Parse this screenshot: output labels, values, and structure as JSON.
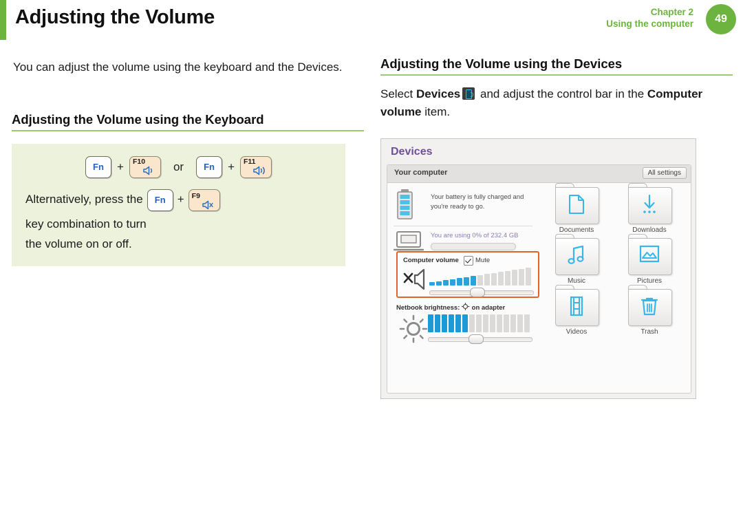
{
  "header": {
    "title": "Adjusting the Volume",
    "chapter_line1": "Chapter 2",
    "chapter_line2": "Using the computer",
    "page_number": "49",
    "accent_green": "#6cb33f"
  },
  "left_column": {
    "intro": "You can adjust the volume using the keyboard and the Devices.",
    "section_heading": "Adjusting the Volume using the Keyboard",
    "callout": {
      "fn_label": "Fn",
      "plus": "+",
      "or_label": "or",
      "key1_label": "F10",
      "key1_icon": "volume-down-icon",
      "key2_label": "F11",
      "key2_icon": "volume-up-icon",
      "alt_text_before": "Alternatively, press the",
      "key3_fn": "Fn",
      "key3_label": "F9",
      "key3_icon": "volume-mute-icon",
      "alt_text_after": "key combination to turn",
      "alt_text_line2": "the volume on or off."
    }
  },
  "right_column": {
    "section_heading": "Adjusting the Volume using the Devices",
    "body_before": "Select ",
    "body_bold1": "Devices",
    "body_icon": "devices-icon",
    "body_middle": " and adjust the control bar in the ",
    "body_bold2": "Computer volume",
    "body_after": " item."
  },
  "devices_panel": {
    "title": "Devices",
    "title_color": "#6f4f9c",
    "group_label": "Your computer",
    "all_settings_button": "All settings",
    "battery": {
      "icon": "battery-icon",
      "text_line1": "Your battery is fully charged and",
      "text_line2": "you're ready to go."
    },
    "storage": {
      "icon": "laptop-icon",
      "label": "You are using",
      "value": "0% of 232.4 GB",
      "value_color": "#8f7bb5",
      "fill_percent": 0
    },
    "computer_volume": {
      "label": "Computer volume",
      "mute_label": "Mute",
      "mute_checked": true,
      "icon": "volume-mute-icon",
      "total_bars": 15,
      "filled_bars": 7,
      "slider_percent": 45,
      "highlight_color": "#e2622a",
      "bar_color": "#29a3dc",
      "bar_empty_color": "#dcdad8"
    },
    "brightness": {
      "label": "Netbook brightness:",
      "icon": "brightness-icon",
      "suffix": "on adapter",
      "sun_icon": "sun-icon",
      "total_bars": 15,
      "filled_bars": 6,
      "slider_percent": 45,
      "bar_color": "#1c9ad6",
      "bar_empty_color": "#dcdad8"
    },
    "folders": [
      {
        "label": "Documents",
        "icon": "document-folder-icon"
      },
      {
        "label": "Downloads",
        "icon": "download-folder-icon"
      },
      {
        "label": "Music",
        "icon": "music-folder-icon"
      },
      {
        "label": "Pictures",
        "icon": "pictures-folder-icon"
      },
      {
        "label": "Videos",
        "icon": "videos-folder-icon"
      },
      {
        "label": "Trash",
        "icon": "trash-folder-icon"
      }
    ]
  }
}
